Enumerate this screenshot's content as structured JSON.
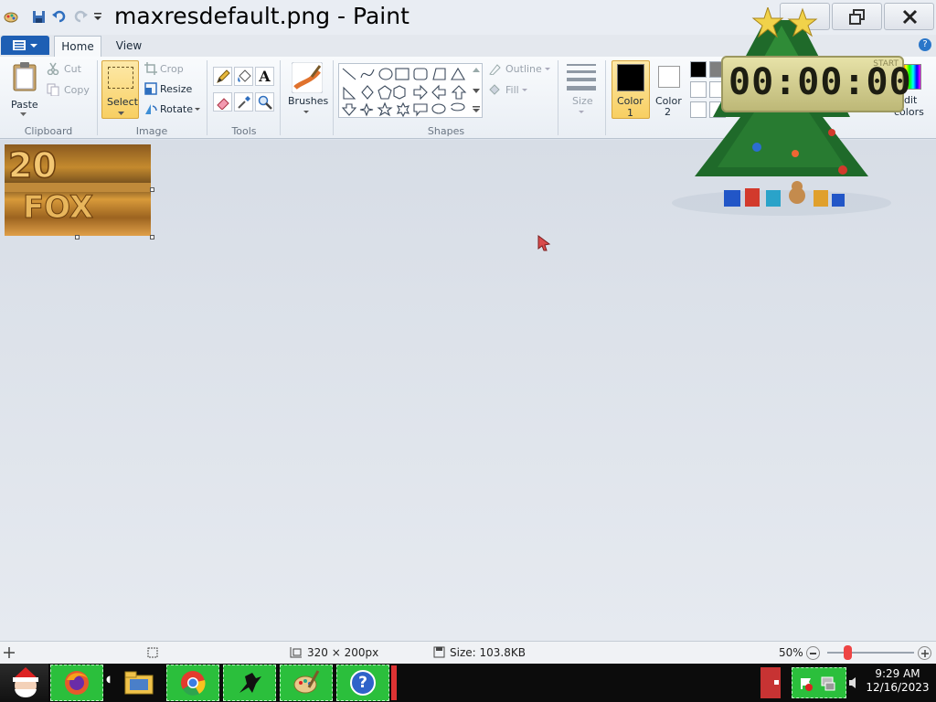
{
  "window": {
    "title": "maxresdefault.png - Paint"
  },
  "quick_access": {
    "icons": [
      "paint-app-icon",
      "save-icon",
      "undo-icon",
      "redo-icon",
      "customize-dropdown-icon"
    ]
  },
  "window_controls": {
    "icons": [
      "minimize-icon",
      "restore-icon",
      "close-icon"
    ]
  },
  "tabs": [
    {
      "label": "Home"
    },
    {
      "label": "View"
    }
  ],
  "ribbon": {
    "clipboard": {
      "label": "Clipboard",
      "paste": "Paste",
      "cut": "Cut",
      "copy": "Copy"
    },
    "image": {
      "label": "Image",
      "select": "Select",
      "crop": "Crop",
      "resize": "Resize",
      "rotate": "Rotate"
    },
    "tools": {
      "label": "Tools",
      "icons": [
        "pencil-icon",
        "fill-bucket-icon",
        "text-icon",
        "eraser-icon",
        "color-picker-icon",
        "magnifier-icon"
      ]
    },
    "brushes": {
      "label": "Brushes"
    },
    "shapes": {
      "label": "Shapes",
      "outline": "Outline",
      "fill": "Fill"
    },
    "size": {
      "label": "Size"
    },
    "colors": {
      "color1": "Color",
      "color1_num": "1",
      "color2": "Color",
      "color2_num": "2",
      "edit": "Edit",
      "edit2": "colors",
      "color1_value": "#000000",
      "color2_value": "#ffffff",
      "palette": [
        "#000000",
        "#7f7f7f",
        "#ffffff",
        "#ffffff",
        "#ffffff",
        "#ffffff"
      ]
    }
  },
  "canvas": {
    "image_name": "maxresdefault.png"
  },
  "gadget": {
    "clock_display": "00:00:00",
    "clock_label": "START"
  },
  "statusbar": {
    "dimensions": "320 × 200px",
    "size": "Size: 103.8KB",
    "zoom": "50%",
    "zoom_level": 0.5
  },
  "taskbar": {
    "apps": [
      "santa-icon",
      "firefox-icon",
      "file-explorer-icon",
      "chrome-icon",
      "game-icon",
      "paint-icon",
      "help-icon"
    ],
    "time": "9:29 AM",
    "date": "12/16/2023"
  },
  "colors": {
    "accent": "#1e5fb4",
    "ribbon_bg": "#f3f6f9",
    "taskbar_bg": "#0c0c0c",
    "taskbar_app": "#2bbf3c"
  }
}
